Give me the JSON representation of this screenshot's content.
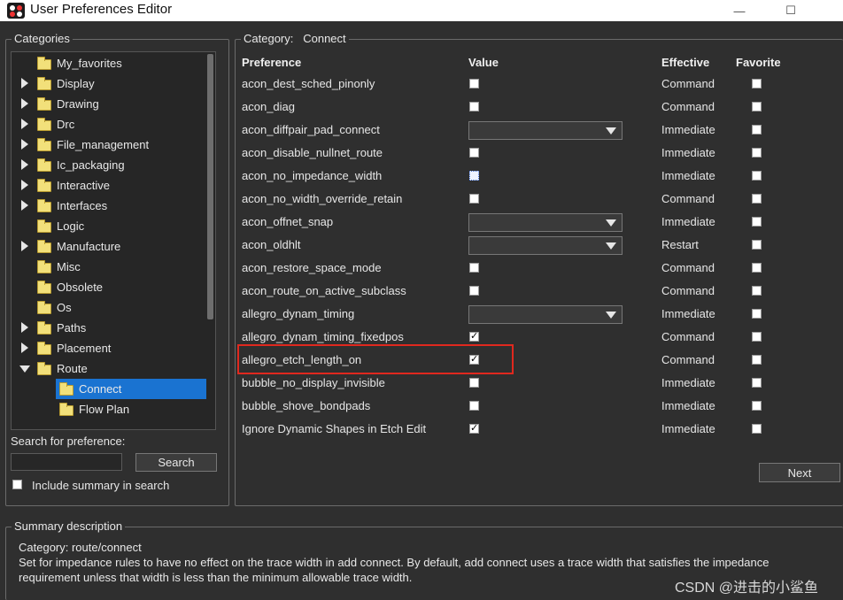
{
  "window": {
    "title": "User Preferences Editor",
    "minimize": "—",
    "maximize": "☐"
  },
  "categories": {
    "group_title": "Categories",
    "items": [
      {
        "label": "My_favorites",
        "expandable": false,
        "level": 0
      },
      {
        "label": "Display",
        "expandable": true,
        "level": 0
      },
      {
        "label": "Drawing",
        "expandable": true,
        "level": 0
      },
      {
        "label": "Drc",
        "expandable": true,
        "level": 0
      },
      {
        "label": "File_management",
        "expandable": true,
        "level": 0
      },
      {
        "label": "Ic_packaging",
        "expandable": true,
        "level": 0
      },
      {
        "label": "Interactive",
        "expandable": true,
        "level": 0
      },
      {
        "label": "Interfaces",
        "expandable": true,
        "level": 0
      },
      {
        "label": "Logic",
        "expandable": false,
        "level": 0
      },
      {
        "label": "Manufacture",
        "expandable": true,
        "level": 0
      },
      {
        "label": "Misc",
        "expandable": false,
        "level": 0
      },
      {
        "label": "Obsolete",
        "expandable": false,
        "level": 0
      },
      {
        "label": "Os",
        "expandable": false,
        "level": 0
      },
      {
        "label": "Paths",
        "expandable": true,
        "level": 0
      },
      {
        "label": "Placement",
        "expandable": true,
        "level": 0
      },
      {
        "label": "Route",
        "expandable": true,
        "expanded": true,
        "level": 0
      },
      {
        "label": "Connect",
        "expandable": false,
        "level": 1,
        "selected": true
      },
      {
        "label": "Flow Plan",
        "expandable": false,
        "level": 1
      }
    ]
  },
  "search": {
    "label": "Search for preference:",
    "value": "",
    "button": "Search",
    "include_summary_label": "Include summary in search",
    "include_summary_checked": false
  },
  "category_panel": {
    "title_prefix": "Category:",
    "title_value": "Connect",
    "headers": {
      "preference": "Preference",
      "value": "Value",
      "effective": "Effective",
      "favorite": "Favorite"
    },
    "rows": [
      {
        "name": "acon_dest_sched_pinonly",
        "type": "checkbox",
        "checked": false,
        "effective": "Command"
      },
      {
        "name": "acon_diag",
        "type": "checkbox",
        "checked": false,
        "effective": "Command"
      },
      {
        "name": "acon_diffpair_pad_connect",
        "type": "combo",
        "value": "",
        "effective": "Immediate"
      },
      {
        "name": "acon_disable_nullnet_route",
        "type": "checkbox",
        "checked": false,
        "effective": "Immediate"
      },
      {
        "name": "acon_no_impedance_width",
        "type": "checkbox",
        "checked": false,
        "focused": true,
        "effective": "Immediate"
      },
      {
        "name": "acon_no_width_override_retain",
        "type": "checkbox",
        "checked": false,
        "effective": "Command"
      },
      {
        "name": "acon_offnet_snap",
        "type": "combo",
        "value": "",
        "effective": "Immediate"
      },
      {
        "name": "acon_oldhlt",
        "type": "combo",
        "value": "",
        "effective": "Restart"
      },
      {
        "name": "acon_restore_space_mode",
        "type": "checkbox",
        "checked": false,
        "effective": "Command"
      },
      {
        "name": "acon_route_on_active_subclass",
        "type": "checkbox",
        "checked": false,
        "effective": "Command"
      },
      {
        "name": "allegro_dynam_timing",
        "type": "combo",
        "value": "",
        "effective": "Immediate"
      },
      {
        "name": "allegro_dynam_timing_fixedpos",
        "type": "checkbox",
        "checked": true,
        "effective": "Command"
      },
      {
        "name": "allegro_etch_length_on",
        "type": "checkbox",
        "checked": true,
        "effective": "Command",
        "highlighted": true
      },
      {
        "name": "bubble_no_display_invisible",
        "type": "checkbox",
        "checked": false,
        "effective": "Immediate"
      },
      {
        "name": "bubble_shove_bondpads",
        "type": "checkbox",
        "checked": false,
        "effective": "Immediate"
      },
      {
        "name": "Ignore Dynamic Shapes in Etch Edit",
        "type": "checkbox",
        "checked": true,
        "effective": "Immediate"
      }
    ],
    "next_button": "Next"
  },
  "summary": {
    "group_title": "Summary description",
    "category_line": "Category: route/connect",
    "description_line1": "Set for impedance rules to have no effect on the trace width in add connect. By default, add connect uses a trace width that satisfies the impedance",
    "description_line2": "requirement unless that width is less than the minimum allowable trace width."
  },
  "watermark": "CSDN @进击的小鲨鱼",
  "colors": {
    "selection": "#1a73d1",
    "highlight_box": "#e0281e",
    "folder": "#f2e07a"
  }
}
